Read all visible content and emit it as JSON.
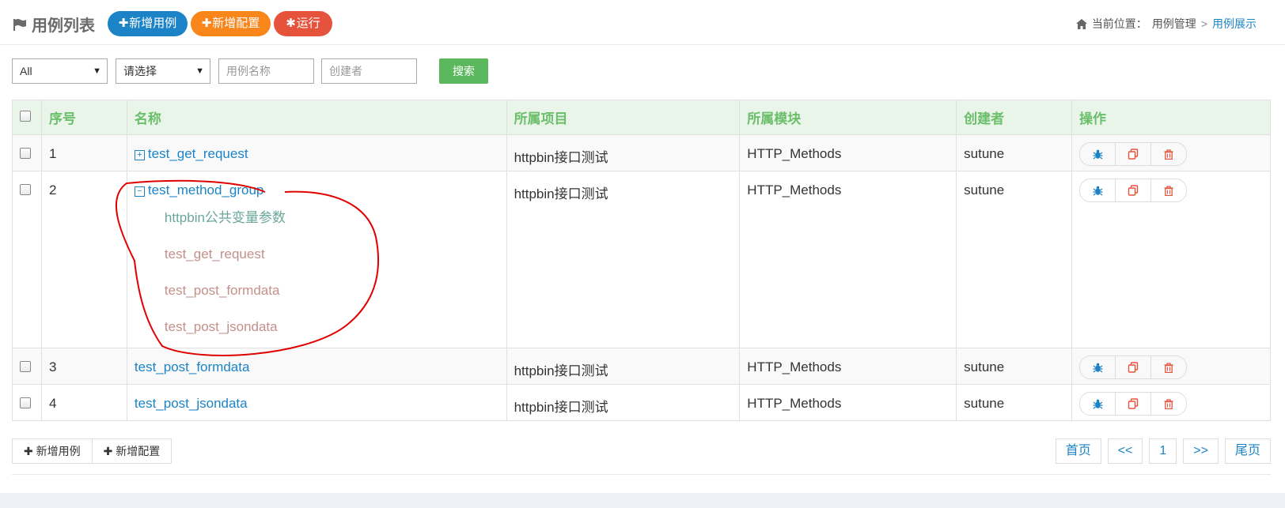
{
  "header": {
    "title": "用例列表",
    "btn_add_case": "新增用例",
    "btn_add_config": "新增配置",
    "btn_run": "运行",
    "breadcrumb_prefix": "当前位置：",
    "breadcrumb_parent": "用例管理",
    "breadcrumb_sep": ">",
    "breadcrumb_current": "用例展示"
  },
  "filters": {
    "select1_value": "All",
    "select2_value": "请选择",
    "name_placeholder": "用例名称",
    "creator_placeholder": "创建者",
    "search_label": "搜索"
  },
  "table": {
    "columns": [
      "序号",
      "名称",
      "所属项目",
      "所属模块",
      "创建者",
      "操作"
    ],
    "rows": [
      {
        "index": "1",
        "name": "test_get_request",
        "toggle": "+",
        "project": "httpbin接口测试",
        "module": "HTTP_Methods",
        "creator": "sutune"
      },
      {
        "index": "2",
        "name": "test_method_group",
        "toggle": "−",
        "project": "httpbin接口测试",
        "module": "HTTP_Methods",
        "creator": "sutune",
        "children": [
          "httpbin公共变量参数",
          "test_get_request",
          "test_post_formdata",
          "test_post_jsondata"
        ]
      },
      {
        "index": "3",
        "name": "test_post_formdata",
        "project": "httpbin接口测试",
        "module": "HTTP_Methods",
        "creator": "sutune"
      },
      {
        "index": "4",
        "name": "test_post_jsondata",
        "project": "httpbin接口测试",
        "module": "HTTP_Methods",
        "creator": "sutune"
      }
    ]
  },
  "bottom": {
    "add_case": "新增用例",
    "add_config": "新增配置"
  },
  "pagination": {
    "first": "首页",
    "prev": "<<",
    "current": "1",
    "next": ">>",
    "last": "尾页"
  },
  "colors": {
    "primary": "#1c84c6",
    "orange": "#f8861a",
    "red": "#e5533d",
    "green": "#5cb85c",
    "header_text": "#6bbf6b",
    "annotation": "#e00000"
  },
  "icons": {
    "op_run": "bug-icon",
    "op_copy": "copy-icon",
    "op_delete": "trash-icon"
  }
}
